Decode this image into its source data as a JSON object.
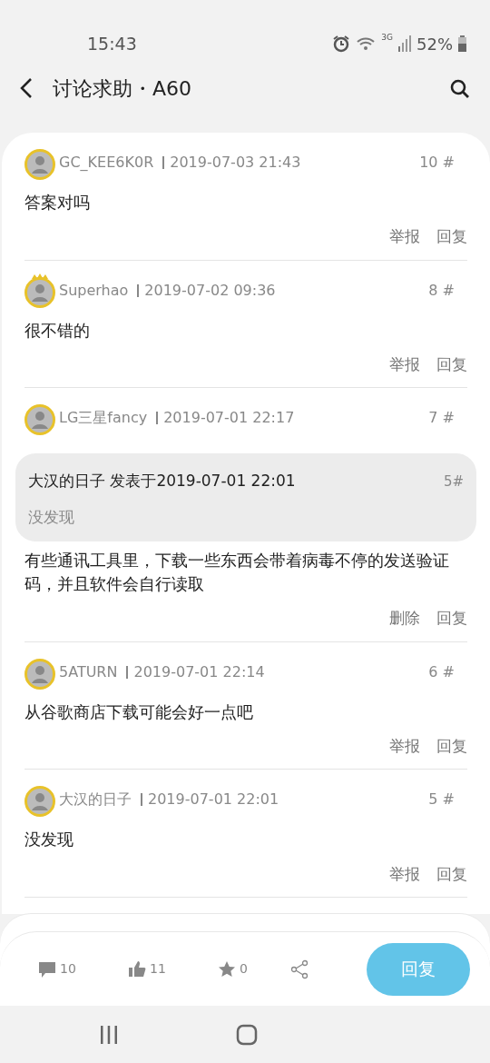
{
  "status_bar": {
    "time": "15:43",
    "network": "3G",
    "battery": "52%"
  },
  "header": {
    "title": "讨论求助・A60"
  },
  "posts": [
    {
      "user": "GC_KEE6K0R",
      "crowned": false,
      "time": "2019-07-03 21:43",
      "floor": "10 #",
      "content": "答案对吗",
      "actions": [
        "举报",
        "回复"
      ]
    },
    {
      "user": "Superhao",
      "crowned": true,
      "time": "2019-07-02 09:36",
      "floor": "8 #",
      "content": "很不错的",
      "actions": [
        "举报",
        "回复"
      ]
    },
    {
      "user": "LG三星fancy",
      "crowned": false,
      "time": "2019-07-01 22:17",
      "floor": "7 #",
      "quote": {
        "author_line": "大汉的日子 发表于2019-07-01 22:01",
        "floor": "5#",
        "text": "没发现"
      },
      "content": "有些通讯工具里，下载一些东西会带着病毒不停的发送验证码，并且软件会自行读取",
      "actions": [
        "删除",
        "回复"
      ]
    },
    {
      "user": "5ATURN",
      "crowned": false,
      "time": "2019-07-01 22:14",
      "floor": "6 #",
      "content": "从谷歌商店下载可能会好一点吧",
      "actions": [
        "举报",
        "回复"
      ]
    },
    {
      "user": "大汉的日子",
      "crowned": false,
      "time": "2019-07-01 22:01",
      "floor": "5 #",
      "content": "没发现",
      "actions": [
        "举报",
        "回复"
      ]
    }
  ],
  "toolbar": {
    "comments": "10",
    "likes": "11",
    "favorites": "0",
    "reply_button": "回复"
  }
}
